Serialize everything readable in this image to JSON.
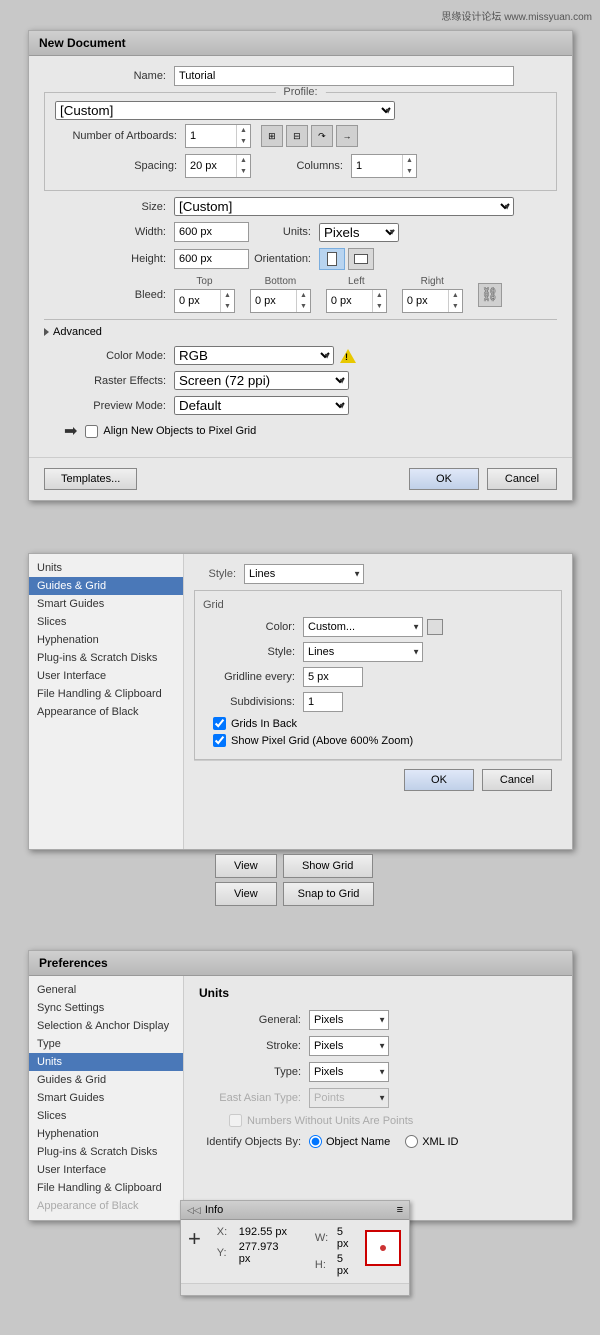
{
  "watermark": {
    "text": "思缘设计论坛  www.missyuan.com"
  },
  "new_doc_dialog": {
    "title": "New Document",
    "name_label": "Name:",
    "name_value": "Tutorial",
    "profile_label": "Profile:",
    "profile_value": "[Custom]",
    "artboards_label": "Number of Artboards:",
    "artboards_value": "1",
    "spacing_label": "Spacing:",
    "spacing_value": "20 px",
    "columns_label": "Columns:",
    "columns_value": "1",
    "size_label": "Size:",
    "size_value": "[Custom]",
    "width_label": "Width:",
    "width_value": "600 px",
    "units_label": "Units:",
    "units_value": "Pixels",
    "height_label": "Height:",
    "height_value": "600 px",
    "orientation_label": "Orientation:",
    "bleed_label": "Bleed:",
    "bleed_top_label": "Top",
    "bleed_bottom_label": "Bottom",
    "bleed_left_label": "Left",
    "bleed_right_label": "Right",
    "bleed_top_value": "0 px",
    "bleed_bottom_value": "0 px",
    "bleed_left_value": "0 px",
    "bleed_right_value": "0 px",
    "advanced_label": "Advanced",
    "color_mode_label": "Color Mode:",
    "color_mode_value": "RGB",
    "raster_effects_label": "Raster Effects:",
    "raster_effects_value": "Screen (72 ppi)",
    "preview_mode_label": "Preview Mode:",
    "preview_mode_value": "Default",
    "align_pixel_label": "Align New Objects to Pixel Grid",
    "templates_btn": "Templates...",
    "ok_btn": "OK",
    "cancel_btn": "Cancel"
  },
  "prefs_small_dialog": {
    "title": "Preferences",
    "sidebar_items": [
      "Units",
      "Guides & Grid",
      "Smart Guides",
      "Slices",
      "Hyphenation",
      "Plug-ins & Scratch Disks",
      "User Interface",
      "File Handling & Clipboard",
      "Appearance of Black"
    ],
    "active_item": "Guides & Grid",
    "style_label": "Style:",
    "style_value": "Lines",
    "grid_section_title": "Grid",
    "color_label": "Color:",
    "color_value": "Custom...",
    "grid_style_label": "Style:",
    "grid_style_value": "Lines",
    "gridline_label": "Gridline every:",
    "gridline_value": "5 px",
    "subdivisions_label": "Subdivisions:",
    "subdivisions_value": "1",
    "grids_in_back": "Grids In Back",
    "show_pixel_grid": "Show Pixel Grid (Above 600% Zoom)",
    "ok_btn": "OK",
    "cancel_btn": "Cancel"
  },
  "view_grid_buttons": {
    "view1_label": "View",
    "show_grid_label": "Show Grid",
    "view2_label": "View",
    "snap_grid_label": "Snap to Grid"
  },
  "full_prefs_dialog": {
    "title": "Preferences",
    "sidebar_items": [
      "General",
      "Sync Settings",
      "Selection & Anchor Display",
      "Type",
      "Units",
      "Guides & Grid",
      "Smart Guides",
      "Slices",
      "Hyphenation",
      "Plug-ins & Scratch Disks",
      "User Interface",
      "File Handling & Clipboard",
      "Appearance of Black"
    ],
    "active_item": "Units",
    "units_section_title": "Units",
    "general_label": "General:",
    "general_value": "Pixels",
    "stroke_label": "Stroke:",
    "stroke_value": "Pixels",
    "type_label": "Type:",
    "type_value": "Pixels",
    "east_asian_label": "East Asian Type:",
    "east_asian_value": "Points",
    "numbers_label": "Numbers Without Units Are Points",
    "identify_label": "Identify Objects By:",
    "object_name_label": "Object Name",
    "xml_id_label": "XML ID"
  },
  "info_panel": {
    "title": "Info",
    "x_label": "X:",
    "x_value": "192.55 px",
    "y_label": "Y:",
    "y_value": "277.973 px",
    "w_label": "W:",
    "w_value": "5 px",
    "h_label": "H:",
    "h_value": "5 px"
  }
}
